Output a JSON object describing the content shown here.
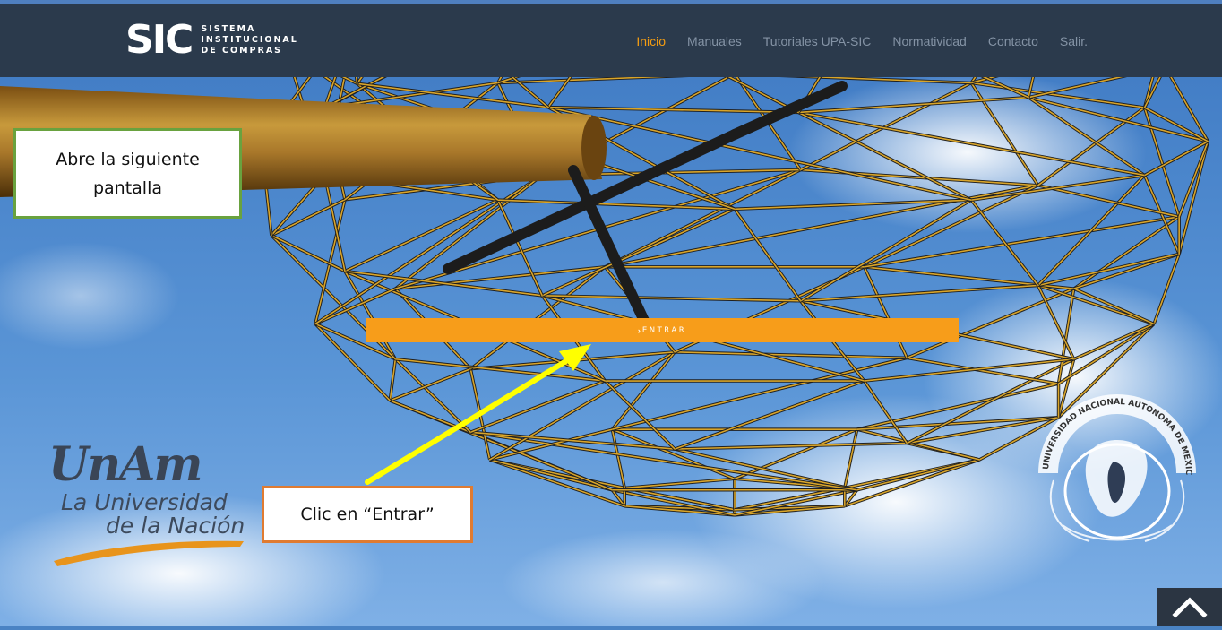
{
  "header": {
    "logo_mark": "SIC",
    "logo_lines": [
      "SISTEMA",
      "INSTITUCIONAL",
      "DE COMPRAS"
    ],
    "nav": [
      {
        "label": "Inicio",
        "active": true
      },
      {
        "label": "Manuales",
        "active": false
      },
      {
        "label": "Tutoriales UPA-SIC",
        "active": false
      },
      {
        "label": "Normatividad",
        "active": false
      },
      {
        "label": "Contacto",
        "active": false
      },
      {
        "label": "Salir.",
        "active": false
      }
    ]
  },
  "hero": {
    "enter_label": "ENTRAR",
    "enter_icon": "chevron-right-icon"
  },
  "annotations": {
    "top_callout": "Abre la siguiente pantalla",
    "bottom_callout": "Clic en “Entrar”",
    "arrow_color": "#ffff00",
    "top_border_color": "#69a23f",
    "bottom_border_color": "#e07b31"
  },
  "branding": {
    "unam_title": "UnAm",
    "unam_line1": "La Universidad",
    "unam_line2": "de la Nación",
    "seal_text": "UNIVERSIDAD NACIONAL AUTONOMA DE MEXICO"
  },
  "colors": {
    "header_bg": "#2b3a4c",
    "accent": "#f79d1a",
    "nav_text": "#8493a5",
    "nav_active": "#f39c12"
  }
}
